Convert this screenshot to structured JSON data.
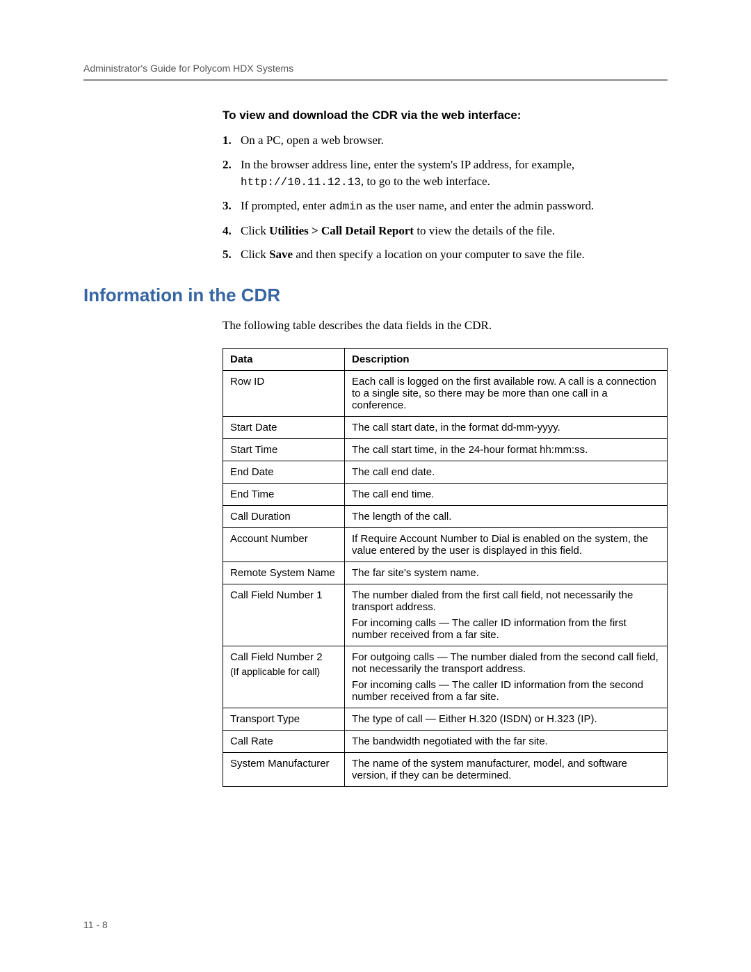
{
  "header": {
    "running_title": "Administrator's Guide for Polycom HDX Systems"
  },
  "procedure": {
    "title": "To view and download the CDR via the web interface:",
    "steps": [
      {
        "n": "1.",
        "pre": "On a PC, open a web browser."
      },
      {
        "n": "2.",
        "pre": "In the browser address line, enter the system's IP address, for example, ",
        "code": "http://10.11.12.13",
        "post": ", to go to the web interface."
      },
      {
        "n": "3.",
        "pre": "If prompted, enter ",
        "code": "admin",
        "post": " as the user name, and enter the admin password."
      },
      {
        "n": "4.",
        "pre": "Click ",
        "bold": "Utilities > Call Detail Report",
        "post": " to view the details of the file."
      },
      {
        "n": "5.",
        "pre": "Click ",
        "bold": "Save",
        "post": " and then specify a location on your computer to save the file."
      }
    ]
  },
  "section": {
    "title": "Information in the CDR",
    "intro": "The following table describes the data fields in the CDR."
  },
  "table": {
    "head_data": "Data",
    "head_desc": "Description",
    "rows": [
      {
        "data": "Row ID",
        "desc": [
          "Each call is logged on the first available row. A call is a connection to a single site, so there may be more than one call in a conference."
        ]
      },
      {
        "data": "Start Date",
        "desc": [
          "The call start date, in the format dd-mm-yyyy."
        ]
      },
      {
        "data": "Start Time",
        "desc": [
          "The call start time, in the 24-hour format hh:mm:ss."
        ]
      },
      {
        "data": "End Date",
        "desc": [
          "The call end date."
        ]
      },
      {
        "data": "End Time",
        "desc": [
          "The call end time."
        ]
      },
      {
        "data": "Call Duration",
        "desc": [
          "The length of the call."
        ]
      },
      {
        "data": "Account Number",
        "desc": [
          "If Require Account Number to Dial is enabled on the system, the value entered by the user is displayed in this field."
        ]
      },
      {
        "data": "Remote System Name",
        "desc": [
          "The far site's system name."
        ]
      },
      {
        "data": "Call Field Number 1",
        "desc": [
          "The number dialed from the first call field, not necessarily the transport address.",
          "For incoming calls — The caller ID information from the first number received from a far site."
        ]
      },
      {
        "data": "Call Field Number 2",
        "data_sub": "(If applicable for call)",
        "desc": [
          "For outgoing calls — The number dialed from the second call field, not necessarily the transport address.",
          "For incoming calls — The caller ID information from the second number received from a far site."
        ]
      },
      {
        "data": "Transport Type",
        "desc": [
          "The type of call — Either H.320 (ISDN) or H.323 (IP)."
        ]
      },
      {
        "data": "Call Rate",
        "desc": [
          "The bandwidth negotiated with the far site."
        ]
      },
      {
        "data": "System Manufacturer",
        "desc": [
          "The name of the system manufacturer, model, and software version, if they can be determined."
        ]
      }
    ]
  },
  "footer": {
    "page": "11 - 8"
  }
}
